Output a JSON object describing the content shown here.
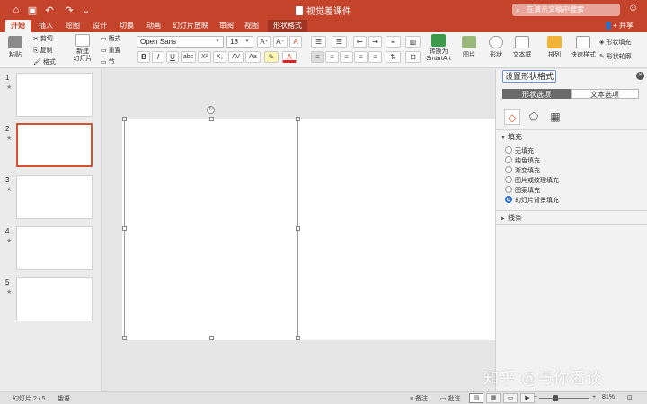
{
  "window": {
    "doc_title": "视觉差课件",
    "search_placeholder": "在演示文稿中搜索",
    "share_label": "共享"
  },
  "quick_access": {
    "home_icon": "⌂",
    "save_icon": "▣",
    "undo_icon": "↶",
    "redo_icon": "↷",
    "more_icon": "⌄"
  },
  "tabs": [
    {
      "label": "开始"
    },
    {
      "label": "插入"
    },
    {
      "label": "绘图"
    },
    {
      "label": "设计"
    },
    {
      "label": "切换"
    },
    {
      "label": "动画"
    },
    {
      "label": "幻灯片放映"
    },
    {
      "label": "审阅"
    },
    {
      "label": "视图"
    },
    {
      "label": "形状格式"
    }
  ],
  "ribbon": {
    "paste": "粘贴",
    "cut": "剪切",
    "copy": "复制",
    "format_painter": "格式",
    "new_slide": "新建\n幻灯片",
    "layout": "版式",
    "reset": "重置",
    "section": "节",
    "font_name": "Open Sans",
    "font_size": "18",
    "convert_smartart": "转换为\nSmartArt",
    "picture": "图片",
    "shape": "形状",
    "textbox": "文本框",
    "arrange": "排列",
    "quick_styles": "快速样式",
    "shape_fill": "形状填充",
    "shape_outline": "形状轮廓"
  },
  "format_buttons": {
    "bold": "B",
    "italic": "I",
    "underline": "U",
    "strike": "abc",
    "superscript": "X²",
    "subscript": "X₂"
  },
  "slides": [
    {
      "num": "1"
    },
    {
      "num": "2"
    },
    {
      "num": "3"
    },
    {
      "num": "4"
    },
    {
      "num": "5"
    }
  ],
  "format_pane": {
    "title": "设置形状格式",
    "tab_shape": "形状选项",
    "tab_text": "文本选项",
    "section_fill": "填充",
    "fill_options": [
      "无填充",
      "纯色填充",
      "渐变填充",
      "图片或纹理填充",
      "图案填充",
      "幻灯片背景填充"
    ],
    "selected_fill_index": 5,
    "section_line": "线条"
  },
  "status": {
    "slide_info": "幻灯片 2 / 5",
    "language": "俄语",
    "notes": "备注",
    "comments": "批注",
    "zoom": "81%"
  },
  "watermark": "知乎 @与你潘谈",
  "colors": {
    "accent": "#c4432b",
    "selected_slide_border": "#d35230",
    "radio_selected": "#2d6fd6"
  }
}
